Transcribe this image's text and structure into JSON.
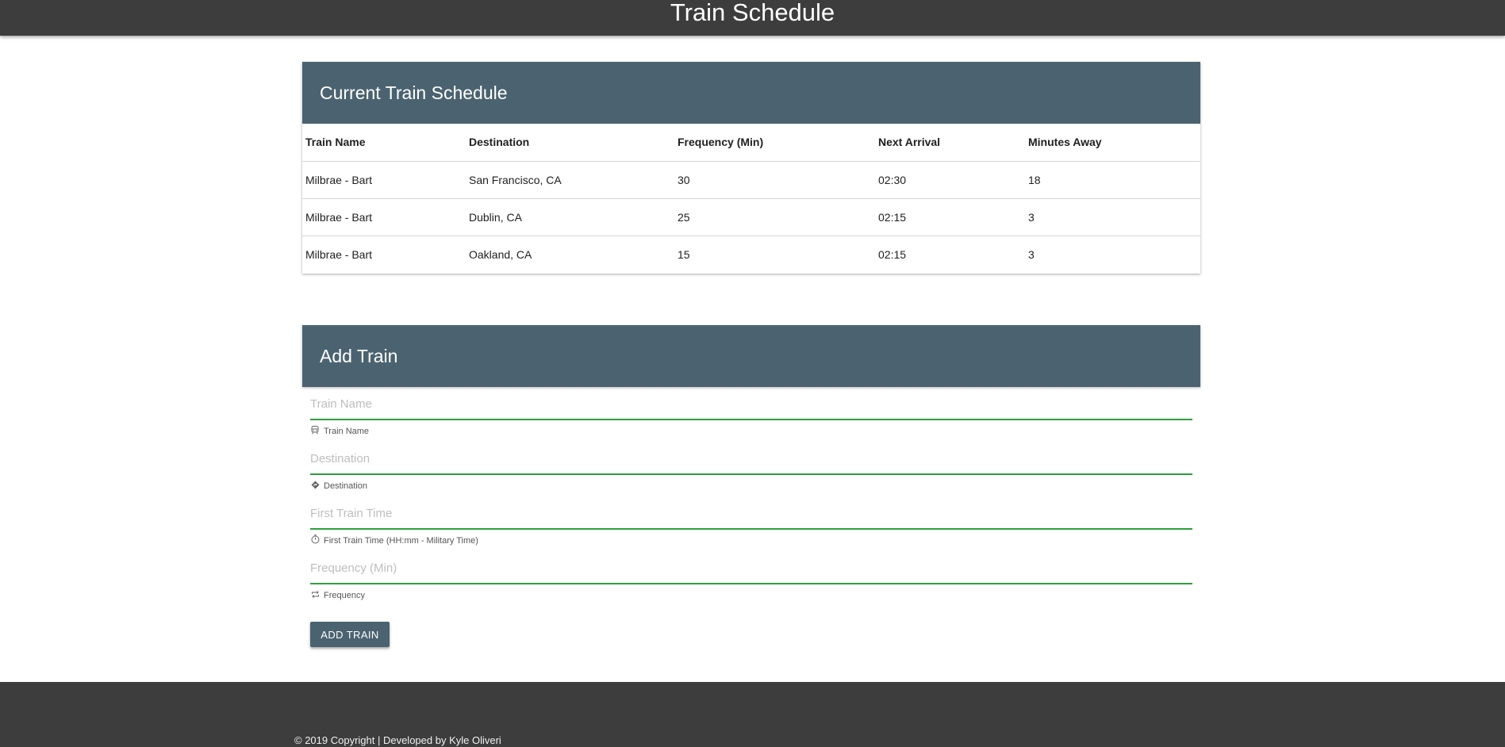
{
  "header": {
    "title": "Train Schedule"
  },
  "schedule": {
    "title": "Current Train Schedule",
    "columns": [
      "Train Name",
      "Destination",
      "Frequency (Min)",
      "Next Arrival",
      "Minutes Away"
    ],
    "rows": [
      [
        "Milbrae - Bart",
        "San Francisco, CA",
        "30",
        "02:30",
        "18"
      ],
      [
        "Milbrae - Bart",
        "Dublin, CA",
        "25",
        "02:15",
        "3"
      ],
      [
        "Milbrae - Bart",
        "Oakland, CA",
        "15",
        "02:15",
        "3"
      ]
    ]
  },
  "add_train": {
    "title": "Add Train",
    "fields": [
      {
        "placeholder": "Train Name",
        "helper": "Train Name",
        "icon": "train-icon"
      },
      {
        "placeholder": "Destination",
        "helper": "Destination",
        "icon": "directions-icon"
      },
      {
        "placeholder": "First Train Time",
        "helper": "First Train Time (HH:mm - Military Time)",
        "icon": "timer-icon"
      },
      {
        "placeholder": "Frequency (Min)",
        "helper": "Frequency",
        "icon": "repeat-icon"
      }
    ],
    "button_label": "Add Train"
  },
  "footer": {
    "text": "© 2019 Copyright | Developed by Kyle Oliveri"
  },
  "colors": {
    "header_bg": "#3d3d3d",
    "card_header": "#4b6370",
    "input_underline": "#2e9e3e"
  }
}
